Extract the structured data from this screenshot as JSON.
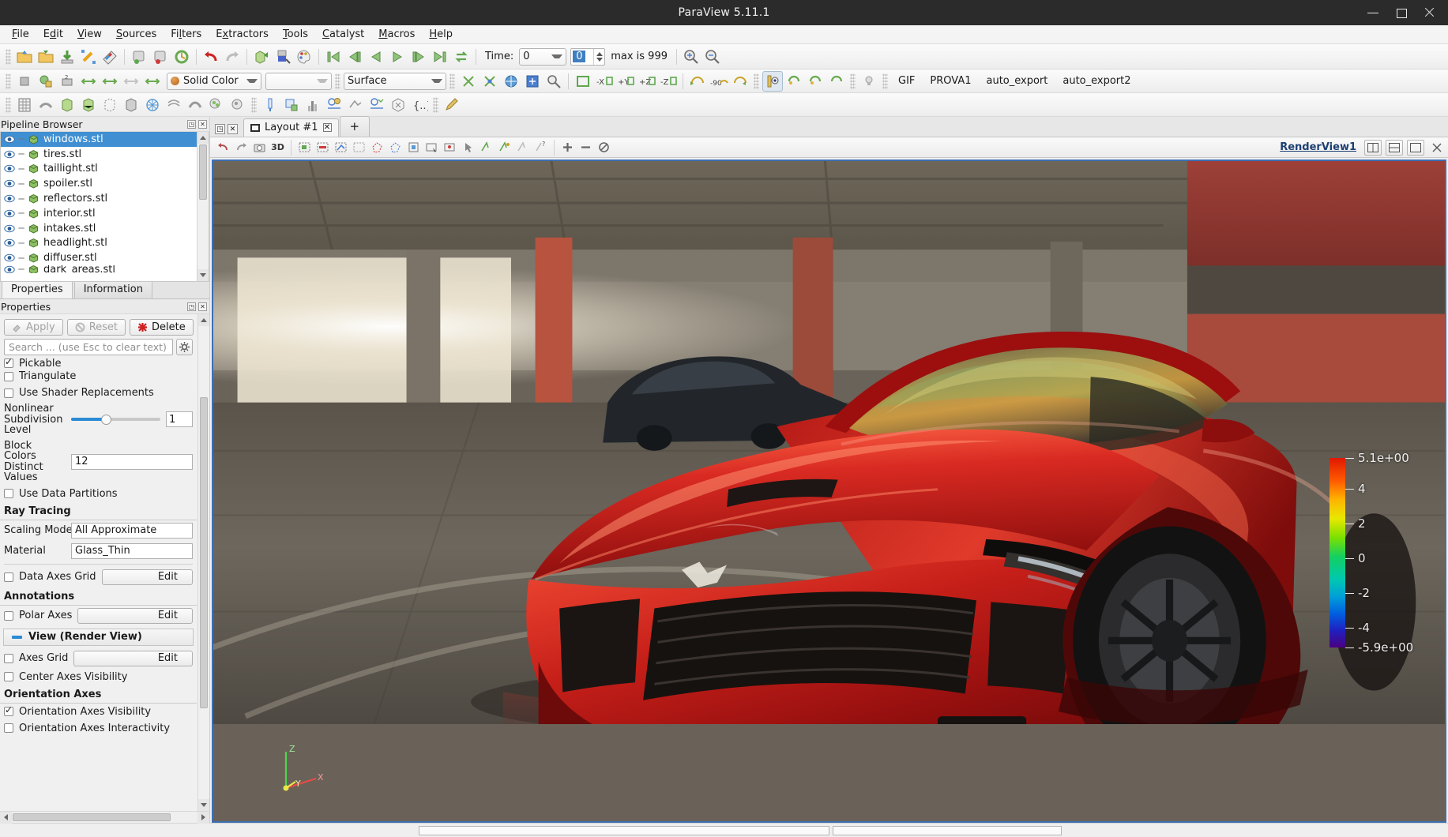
{
  "window": {
    "title": "ParaView 5.11.1"
  },
  "menu": {
    "items": [
      "File",
      "Edit",
      "View",
      "Sources",
      "Filters",
      "Extractors",
      "Tools",
      "Catalyst",
      "Macros",
      "Help"
    ]
  },
  "toolbar_time": {
    "label": "Time:",
    "time_value": "0",
    "frame_value": "0",
    "max_label": "max is 999"
  },
  "toolbar_repr": {
    "coloring": "Solid Color",
    "array_component": "",
    "representation": "Surface"
  },
  "toolbar_macros": {
    "items": [
      "GIF",
      "PROVA1",
      "auto_export",
      "auto_export2"
    ]
  },
  "pipeline": {
    "title": "Pipeline Browser",
    "items": [
      {
        "label": "windows.stl",
        "selected": true
      },
      {
        "label": "tires.stl",
        "selected": false
      },
      {
        "label": "taillight.stl",
        "selected": false
      },
      {
        "label": "spoiler.stl",
        "selected": false
      },
      {
        "label": "reflectors.stl",
        "selected": false
      },
      {
        "label": "interior.stl",
        "selected": false
      },
      {
        "label": "intakes.stl",
        "selected": false
      },
      {
        "label": "headlight.stl",
        "selected": false
      },
      {
        "label": "diffuser.stl",
        "selected": false
      },
      {
        "label": "dark_areas.stl",
        "selected": false
      }
    ]
  },
  "panel_tabs": {
    "items": [
      "Properties",
      "Information"
    ],
    "active": "Properties"
  },
  "properties": {
    "title": "Properties",
    "buttons": {
      "apply": "Apply",
      "reset": "Reset",
      "delete": "Delete",
      "help": "?"
    },
    "search_placeholder": "Search ... (use Esc to clear text)",
    "rows": [
      {
        "type": "checkbox",
        "label": "Pickable",
        "checked": true
      },
      {
        "type": "checkbox",
        "label": "Triangulate",
        "checked": false
      },
      {
        "type": "checkbox",
        "label": "Use Shader Replacements",
        "checked": false
      },
      {
        "type": "slider",
        "label": "Nonlinear Subdivision Level",
        "value": "1"
      },
      {
        "type": "text",
        "label": "Block Colors Distinct Values",
        "value": "12"
      },
      {
        "type": "checkbox",
        "label": "Use Data Partitions",
        "checked": false
      }
    ],
    "ray_tracing": {
      "header": "Ray Tracing",
      "scaling_mode_label": "Scaling Mode",
      "scaling_mode_value": "All Approximate",
      "material_label": "Material",
      "material_value": "Glass_Thin"
    },
    "data_axes_grid": {
      "label": "Data Axes Grid",
      "checked": false,
      "edit": "Edit"
    },
    "annotations": {
      "header": "Annotations",
      "polar_axes_label": "Polar Axes",
      "polar_axes_checked": false,
      "polar_axes_edit": "Edit"
    },
    "view_section": {
      "header": "View (Render View)",
      "axes_grid_label": "Axes Grid",
      "axes_grid_edit": "Edit",
      "center_axes_label": "Center Axes Visibility",
      "orientation_header": "Orientation Axes",
      "orientation_visibility_label": "Orientation Axes Visibility",
      "orientation_visibility_checked": true,
      "orientation_interactivity_label": "Orientation Axes Interactivity",
      "orientation_interactivity_checked": false
    }
  },
  "layout": {
    "tab_label": "Layout #1",
    "add_label": "+"
  },
  "view": {
    "name": "RenderView1",
    "mode_3d": "3D",
    "orientation_axes": {
      "x": "X",
      "y": "Y",
      "z": "Z"
    }
  },
  "chart_data": {
    "type": "colorbar",
    "title": "",
    "colormap": "Rainbow Desaturated (Cool to Warm extended)",
    "orientation": "vertical",
    "range": [
      -5.9,
      5.1
    ],
    "tick_labels": [
      "5.1e+00",
      "4",
      "2",
      "0",
      "-2",
      "-4",
      "-5.9e+00"
    ],
    "tick_values": [
      5.1,
      4,
      2,
      0,
      -2,
      -4,
      -5.9
    ]
  },
  "colors": {
    "accent": "#3f8fd2",
    "selection": "#3f8fd2",
    "view_border": "#3c6fb5",
    "viewname": "#1d3f73",
    "delete_icon": "#cc2222",
    "titlebar": "#2b2b2b"
  }
}
